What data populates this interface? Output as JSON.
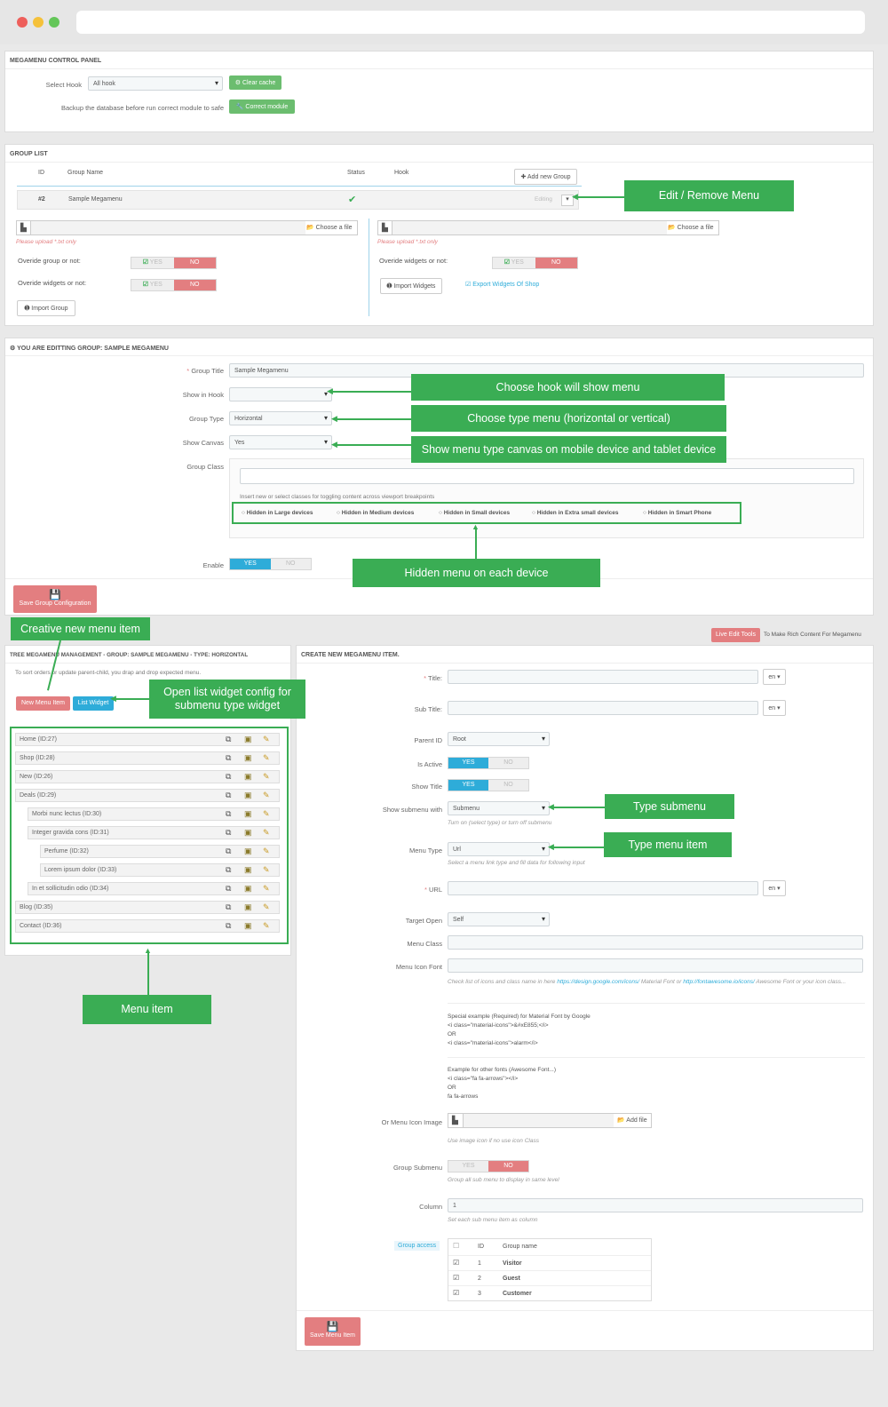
{
  "control_panel": {
    "title": "MEGAMENU CONTROL PANEL",
    "select_hook_label": "Select Hook",
    "select_hook_value": "All hook",
    "clear_cache": "Clear cache",
    "backup_text": "Backup the database before run correct module to safe",
    "correct_module": "Correct module"
  },
  "group_list": {
    "title": "GROUP LIST",
    "col_id": "ID",
    "col_name": "Group Name",
    "col_status": "Status",
    "col_hook": "Hook",
    "add_group": "Add new Group",
    "row_id": "#2",
    "row_name": "Sample Megamenu",
    "row_status": "✔",
    "row_action": "Editing",
    "choose_file": "Choose a file",
    "upload_note": "Please upload *.txt only",
    "override_group": "Overide group or not:",
    "override_widgets": "Overide widgets or not:",
    "yes": "YES",
    "no": "NO",
    "import_group": "Import Group",
    "import_widgets": "Import Widgets",
    "export_widgets": "Export Widgets Of Shop"
  },
  "edit_group": {
    "title": "YOU ARE EDITTING GROUP: SAMPLE MEGAMENU",
    "group_title_label": "Group Title",
    "group_title_value": "Sample Megamenu",
    "show_in_hook_label": "Show in Hook",
    "group_type_label": "Group Type",
    "group_type_value": "Horizontal",
    "show_canvas_label": "Show Canvas",
    "show_canvas_value": "Yes",
    "group_class_label": "Group Class",
    "class_hint": "Insert new or select classes for toggling content across viewport breakpoints",
    "hidden": [
      "Hidden in Large devices",
      "Hidden in Medium devices",
      "Hidden in Small devices",
      "Hidden in Extra small devices",
      "Hidden in Smart Phone"
    ],
    "enable_label": "Enable",
    "yes": "YES",
    "no": "NO",
    "save": "Save Group Configuration"
  },
  "tree": {
    "title": "TREE MEGAMENU MANAGEMENT - GROUP: SAMPLE MEGAMENU - TYPE: HORIZONTAL",
    "hint": "To sort orders or update parent-child, you drap and drop expected menu.",
    "new_item": "New Menu Item",
    "list_widget": "List Widget",
    "items": [
      "Home (ID:27)",
      "Shop (ID:28)",
      "New (ID:26)",
      "Deals (ID:29)",
      "Morbi nunc lectus (ID:30)",
      "Integer gravida cons (ID:31)",
      "Perfume (ID:32)",
      "Lorem ipsum dolor (ID:33)",
      "In et sollicitudin odio (ID:34)",
      "Blog (ID:35)",
      "Contact (ID:36)"
    ]
  },
  "live_edit": {
    "button": "Live Edit Tools",
    "text": "To Make Rich Content For Megamenu"
  },
  "create": {
    "title": "CREATE NEW MEGAMENU ITEM.",
    "title_label": "Title:",
    "subtitle_label": "Sub Title:",
    "lang": "en",
    "parent_label": "Parent ID",
    "parent_value": "Root",
    "active_label": "Is Active",
    "show_title_label": "Show Title",
    "yes": "YES",
    "no": "NO",
    "submenu_label": "Show submenu with",
    "submenu_value": "Submenu",
    "submenu_hint": "Turn on (select type) or turn off submenu",
    "menutype_label": "Menu Type",
    "menutype_value": "Url",
    "menutype_hint": "Select a menu link type and fill data for following input",
    "url_label": "URL",
    "target_label": "Target Open",
    "target_value": "Self",
    "menuclass_label": "Menu Class",
    "iconfont_label": "Menu Icon Font",
    "icon_hint_a": "Check list of icons and class name in here ",
    "icon_link1": "https://design.google.com/icons/",
    "icon_hint_b": " Material Font or ",
    "icon_link2": "http://fontawesome.io/icons/",
    "icon_hint_c": " Awesome Font or your icon class...",
    "special_ex": [
      "Special example (Required) for Material Font by Google",
      "<i class=\"material-icons\">&#xE855;</i>",
      "OR",
      "<i class=\"material-icons\">alarm</i>"
    ],
    "other_ex": [
      "Example for other fonts (Awesome Font...)",
      "<i class=\"fa fa-arrows\"></i>",
      "OR",
      "fa fa-arrows"
    ],
    "iconimage_label": "Or Menu Icon Image",
    "add_file": "Add file",
    "iconimage_hint": "Use image icon if no use icon Class",
    "groupsub_label": "Group Submenu",
    "groupsub_hint": "Group all sub menu to display in same level",
    "column_label": "Column",
    "column_value": "1",
    "column_hint": "Set each sub menu item as column",
    "access_label": "Group access",
    "access_id": "ID",
    "access_name": "Group name",
    "access_rows": [
      {
        "id": "1",
        "name": "Visitor"
      },
      {
        "id": "2",
        "name": "Guest"
      },
      {
        "id": "3",
        "name": "Customer"
      }
    ],
    "save": "Save Menu Item"
  },
  "callouts": {
    "edit_remove": "Edit / Remove Menu",
    "choose_hook": "Choose hook will show menu",
    "choose_type": "Choose type menu (horizontal or vertical)",
    "show_canvas": "Show menu type canvas on mobile device and tablet device",
    "hidden_menu": "Hidden menu on each device",
    "creative": "Creative new menu item",
    "open_list": "Open list widget config for submenu type widget",
    "menu_item": "Menu item",
    "type_submenu": "Type submenu",
    "type_menu_item": "Type menu item"
  },
  "colors": {
    "green": "#3aad54",
    "red": "#e37e80",
    "blue": "#2eacd9"
  }
}
